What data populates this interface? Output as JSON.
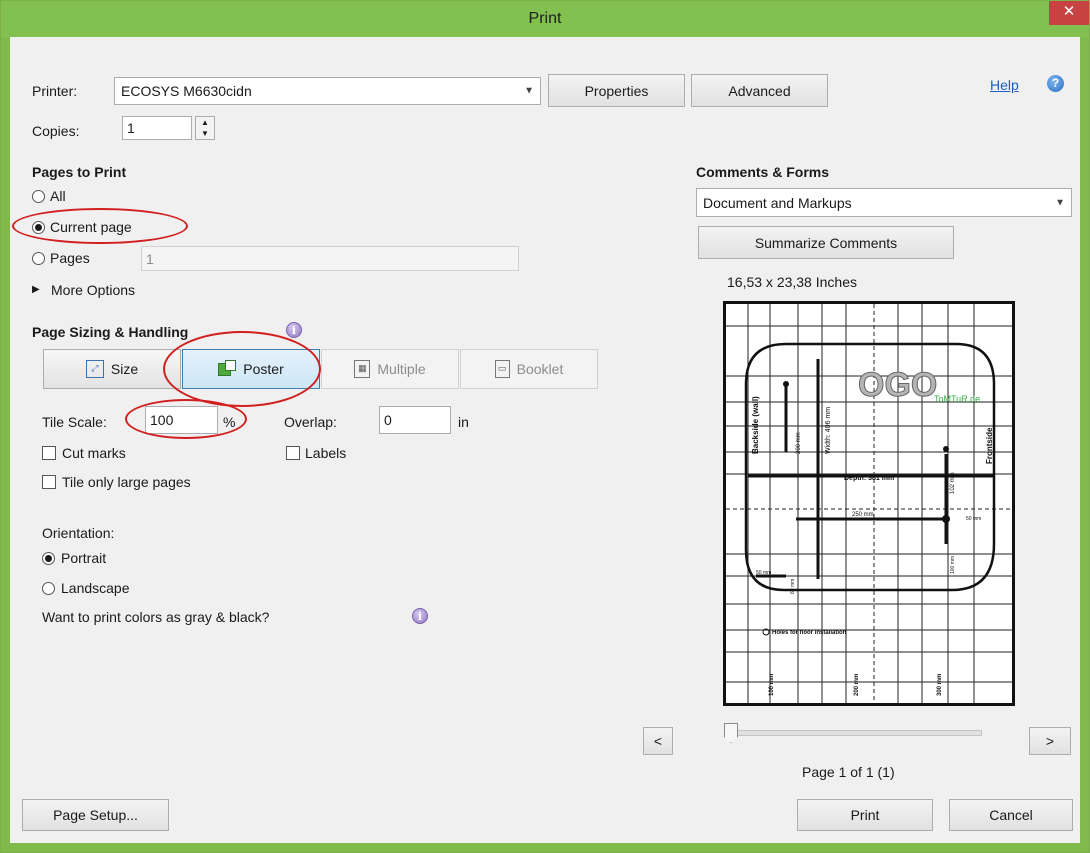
{
  "window": {
    "title": "Print",
    "close_glyph": "✕"
  },
  "printer": {
    "label": "Printer:",
    "selected": "ECOSYS M6630cidn",
    "properties_button": "Properties",
    "advanced_button": "Advanced",
    "help_link": "Help",
    "help_icon": "help-icon"
  },
  "copies": {
    "label": "Copies:",
    "value": "1"
  },
  "pages_to_print": {
    "heading": "Pages to Print",
    "options": [
      "All",
      "Current page",
      "Pages"
    ],
    "selected": "Current page",
    "pages_value": "1",
    "more_options": "More Options"
  },
  "sizing": {
    "heading": "Page Sizing & Handling",
    "buttons": [
      "Size",
      "Poster",
      "Multiple",
      "Booklet"
    ],
    "selected": "Poster",
    "tile_scale_label": "Tile Scale:",
    "tile_scale_value": "100",
    "tile_scale_unit": "%",
    "overlap_label": "Overlap:",
    "overlap_value": "0",
    "overlap_unit": "in",
    "cut_marks": "Cut marks",
    "labels": "Labels",
    "tile_large": "Tile only large pages"
  },
  "orientation": {
    "heading": "Orientation:",
    "options": [
      "Portrait",
      "Landscape"
    ],
    "selected": "Portrait",
    "gray_question": "Want to print colors as gray & black?"
  },
  "comments_forms": {
    "heading": "Comments & Forms",
    "selected": "Document and Markups",
    "summarize_button": "Summarize Comments",
    "page_size": "16,53 x 23,38 Inches"
  },
  "preview": {
    "logo_text": "OGO",
    "brand": "ToMTuR.de",
    "side_left": "Backside (wall)",
    "side_right": "Frontside",
    "width_label": "Width: 406 mm",
    "depth_label": "Depth: 381 mm",
    "dim_200": "200 mm",
    "dim_250": "250 mm",
    "dim_102": "102 mm",
    "dim_50a": "50 mm",
    "dim_50b": "50 mm",
    "dim_60": "60 mm",
    "dim_100": "100 mm",
    "holes_note": "Holes for floor installation",
    "bottom_labels": [
      "100 mm",
      "200 mm",
      "300 mm"
    ],
    "page_counter": "Page 1 of 1 (1)",
    "prev_glyph": "<",
    "next_glyph": ">"
  },
  "footer": {
    "page_setup": "Page Setup...",
    "print": "Print",
    "cancel": "Cancel"
  },
  "colors": {
    "title_bar": "#82c150",
    "close": "#c74343",
    "highlight": "#d11f1f",
    "selected_button": "#cde6f7"
  }
}
